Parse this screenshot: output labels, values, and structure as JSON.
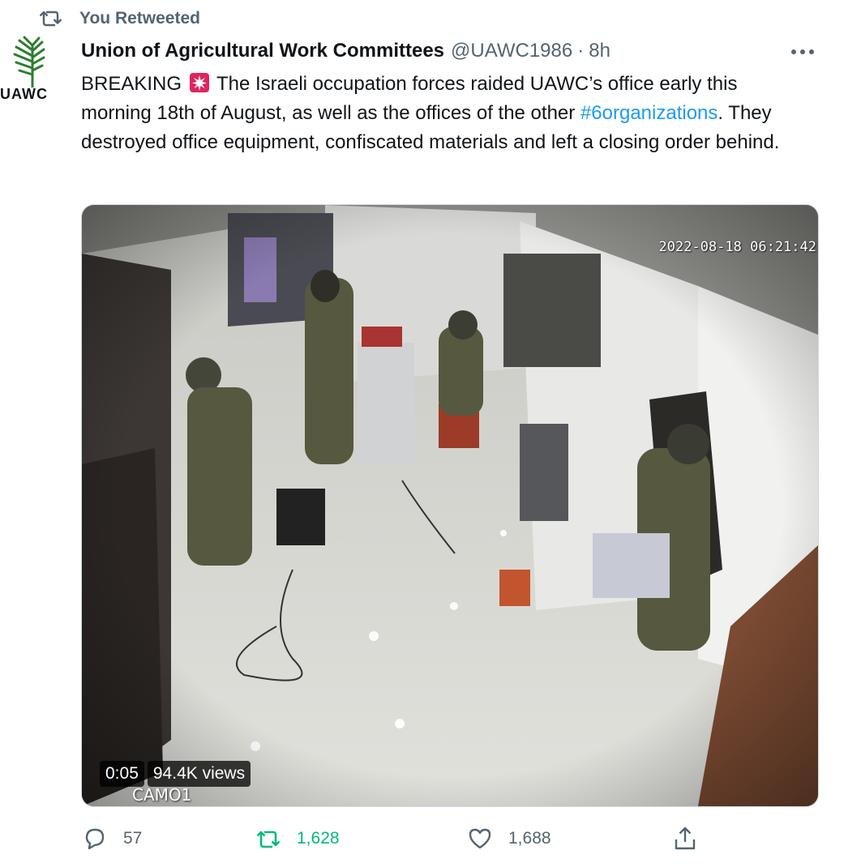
{
  "retweet_header": {
    "text": "You Retweeted",
    "icon": "retweet-icon"
  },
  "author": {
    "avatar_text": "UAWC",
    "name": "Union of Agricultural Work Committees",
    "handle": "@UAWC1986",
    "separator": "·",
    "time": "8h"
  },
  "tweet": {
    "text_part1": "BREAKING",
    "emoji": "rotating-light-icon",
    "text_part2": " The Israeli occupation forces raided UAWC’s office early this morning 18th of August, as well as the offices of the other ",
    "hashtag": "#6organizations",
    "text_part3": ". They destroyed office equipment, confiscated materials and left a closing order behind."
  },
  "media": {
    "camera_timestamp": "2022-08-18 06:21:42",
    "camera_id": "CAMO1",
    "video_time": "0:05",
    "video_views": "94.4K views"
  },
  "actions": {
    "reply_count": "57",
    "retweet_count": "1,628",
    "like_count": "1,688"
  },
  "colors": {
    "accent": "#1d9bf0",
    "retweet_active": "#00ba7c",
    "muted": "#536471",
    "text": "#0f1419"
  }
}
